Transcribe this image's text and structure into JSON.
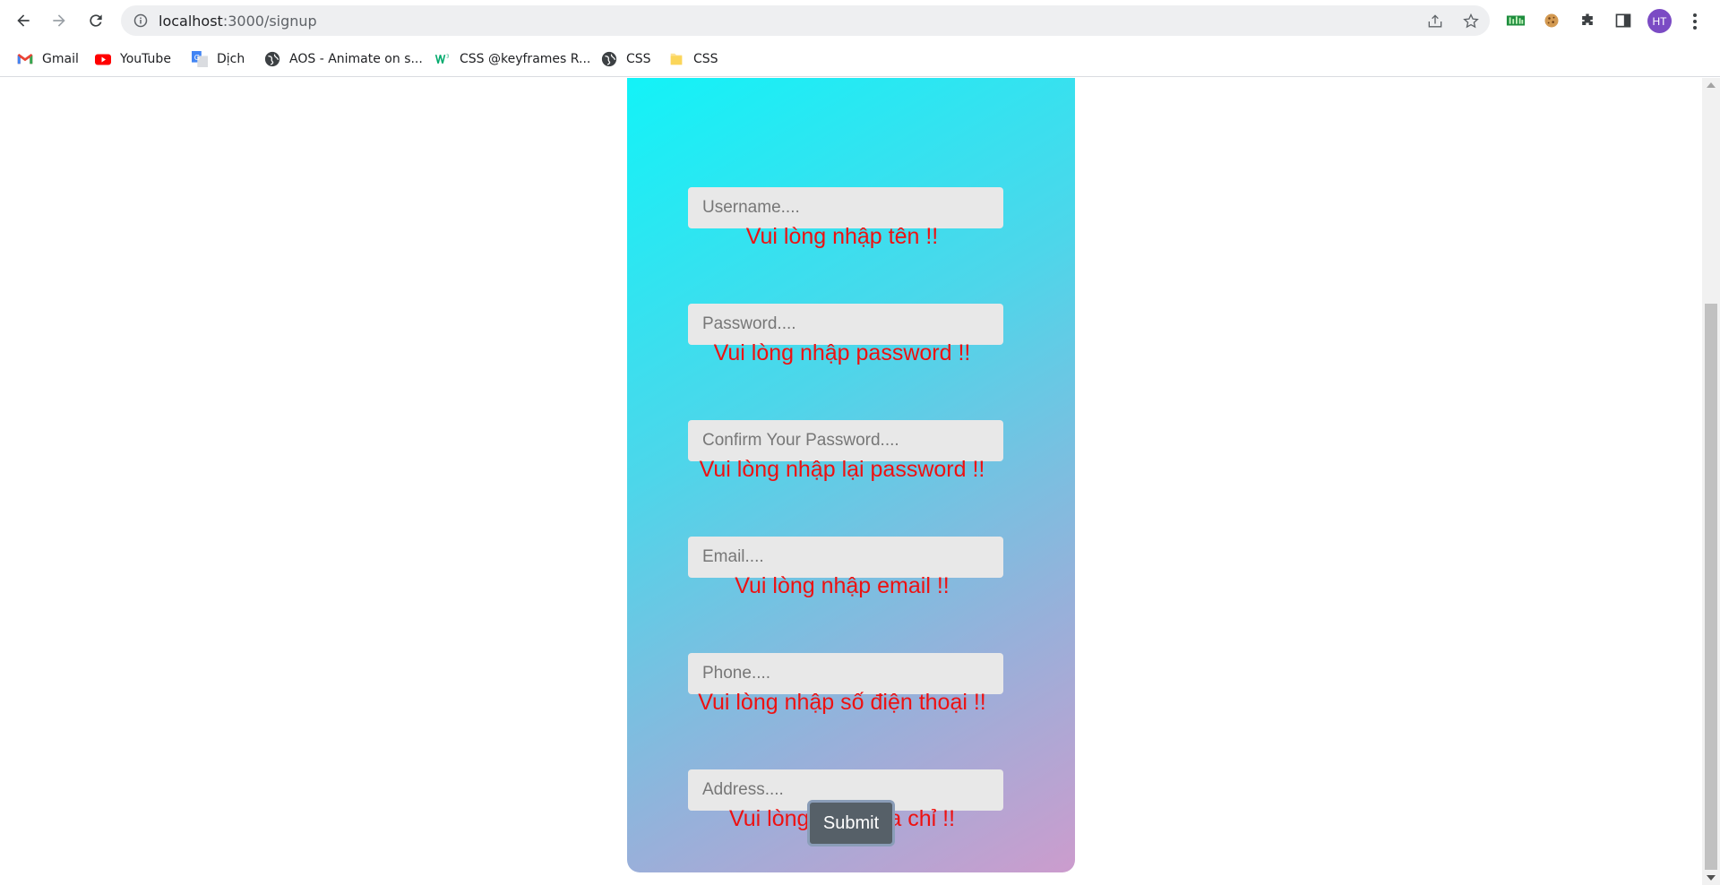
{
  "browser": {
    "url_host": "localhost",
    "url_path": ":3000/signup",
    "profile_initials": "HT",
    "bookmarks": [
      {
        "label": "Gmail",
        "icon": "gmail-icon"
      },
      {
        "label": "YouTube",
        "icon": "youtube-icon"
      },
      {
        "label": "Dịch",
        "icon": "google-translate-icon"
      },
      {
        "label": "AOS - Animate on s...",
        "icon": "globe-icon"
      },
      {
        "label": "CSS @keyframes R...",
        "icon": "w3schools-icon"
      },
      {
        "label": "CSS",
        "icon": "globe-icon"
      },
      {
        "label": "CSS",
        "icon": "folder-icon"
      }
    ]
  },
  "form": {
    "fields": [
      {
        "placeholder": "Username....",
        "error": "Vui lòng nhập tên !!"
      },
      {
        "placeholder": "Password....",
        "error": "Vui lòng nhập password !!"
      },
      {
        "placeholder": "Confirm Your Password....",
        "error": "Vui lòng nhập lại password !!"
      },
      {
        "placeholder": "Email....",
        "error": "Vui lòng nhập email !!"
      },
      {
        "placeholder": "Phone....",
        "error": "Vui lòng nhập số điện thoại !!"
      },
      {
        "placeholder": "Address....",
        "error": "Vui lòng nhập địa chỉ !!"
      }
    ],
    "submit_label": "Submit"
  },
  "colors": {
    "gradient_start": "#10f4f8",
    "gradient_end": "#cc9ccd",
    "error_text": "#ee1111",
    "submit_bg": "#566068"
  }
}
